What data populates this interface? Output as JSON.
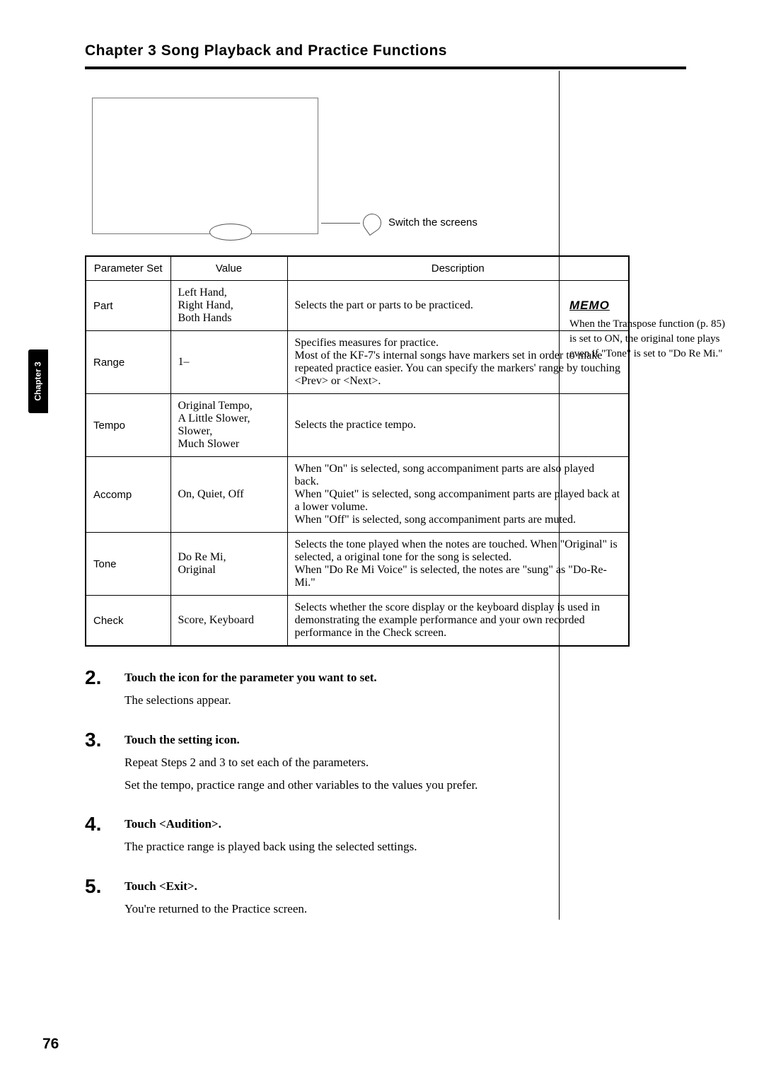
{
  "chapter_title": "Chapter 3 Song Playback and Practice Functions",
  "side_tab": "Chapter 3",
  "figure": {
    "callout": "Switch the screens"
  },
  "table": {
    "headers": {
      "param": "Parameter Set",
      "value": "Value",
      "desc": "Description"
    },
    "rows": [
      {
        "param": "Part",
        "value": "Left Hand,\nRight Hand,\nBoth Hands",
        "desc": "Selects the part or parts to be practiced."
      },
      {
        "param": "Range",
        "value": "1–",
        "desc": "Specifies measures for practice.\nMost of the KF-7's internal songs have markers set in order to make repeated practice easier. You can specify the markers' range by touching <Prev> or <Next>."
      },
      {
        "param": "Tempo",
        "value": "Original Tempo,\nA Little Slower,\nSlower,\nMuch Slower",
        "desc": "Selects the practice tempo."
      },
      {
        "param": "Accomp",
        "value": "On, Quiet, Off",
        "desc": "When \"On\" is selected, song accompaniment parts are also played back.\nWhen \"Quiet\" is selected, song accompaniment parts are played back at a lower volume.\nWhen \"Off\" is selected, song accompaniment parts are muted."
      },
      {
        "param": "Tone",
        "value": "Do Re Mi,\nOriginal",
        "desc": "Selects the tone played when the notes are touched. When \"Original\" is selected, a original tone for the song is selected.\nWhen \"Do Re Mi Voice\" is selected, the notes are \"sung\" as \"Do-Re-Mi.\""
      },
      {
        "param": "Check",
        "value": "Score, Keyboard",
        "desc": "Selects whether the score display or the keyboard display is used in demonstrating the example performance and your own recorded performance in the Check screen."
      }
    ]
  },
  "memo": {
    "label": "MEMO",
    "text": "When the Transpose function (p. 85) is set to ON, the original tone plays even if \"Tone\" is set to \"Do Re Mi.\""
  },
  "steps": [
    {
      "num": "2.",
      "heading": "Touch the icon for the parameter you want to set.",
      "lines": [
        "The selections appear."
      ]
    },
    {
      "num": "3.",
      "heading": "Touch the setting icon.",
      "lines": [
        "Repeat Steps 2 and 3 to set each of the parameters.",
        "Set the tempo, practice range and other variables to the values you prefer."
      ]
    },
    {
      "num": "4.",
      "heading": "Touch <Audition>.",
      "lines": [
        "The practice range is played back using the selected settings."
      ]
    },
    {
      "num": "5.",
      "heading": "Touch <Exit>.",
      "lines": [
        "You're returned to the Practice screen."
      ]
    }
  ],
  "page_number": "76"
}
